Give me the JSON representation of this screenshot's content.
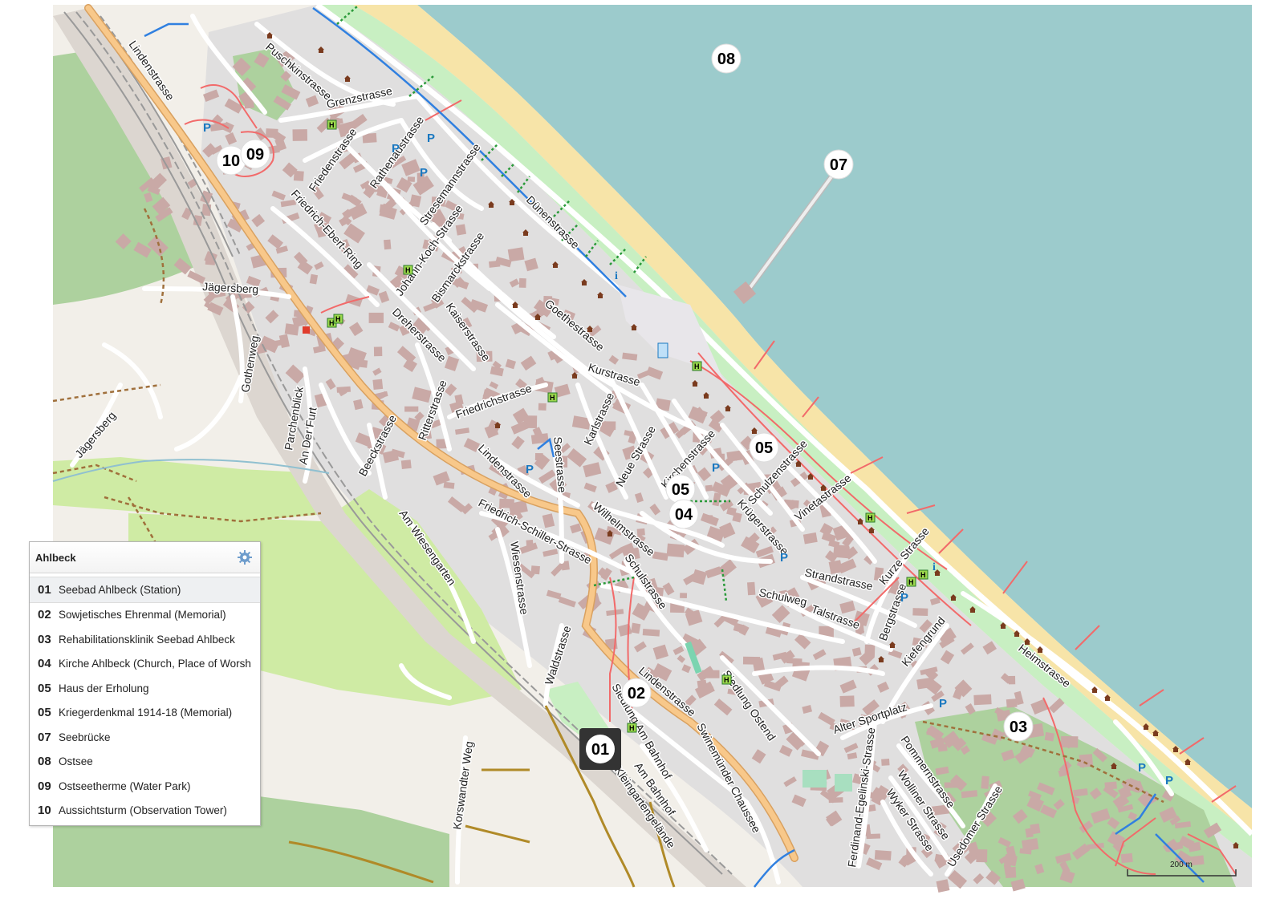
{
  "legend": {
    "title": "Ahlbeck",
    "settings_icon": "gear-icon",
    "items": [
      {
        "num": "01",
        "label": "Seebad Ahlbeck (Station)"
      },
      {
        "num": "02",
        "label": "Sowjetisches Ehrenmal (Memorial)"
      },
      {
        "num": "03",
        "label": "Rehabilitationsklinik Seebad Ahlbeck"
      },
      {
        "num": "04",
        "label": "Kirche Ahlbeck (Church, Place of Worsh"
      },
      {
        "num": "05",
        "label": "Haus der Erholung"
      },
      {
        "num": "05",
        "label": "Kriegerdenkmal 1914-18 (Memorial)"
      },
      {
        "num": "07",
        "label": "Seebrücke"
      },
      {
        "num": "08",
        "label": "Ostsee"
      },
      {
        "num": "09",
        "label": "Ostseetherme (Water Park)"
      },
      {
        "num": "10",
        "label": "Aussichtsturm (Observation Tower)"
      }
    ]
  },
  "markers": {
    "m01": "01",
    "m02": "02",
    "m03": "03",
    "m04": "04",
    "m05a": "05",
    "m05b": "05",
    "m07": "07",
    "m08": "08",
    "m09": "09",
    "m10": "10"
  },
  "streets": {
    "lindenstrasse_nw": "Lindenstrasse",
    "puschkinstrasse": "Puschkinstrasse",
    "grenzstrasse": "Grenzstrasse",
    "friedenstrasse": "Friedenstrasse",
    "rathenaustrasse": "Rathenaustrasse",
    "stresemannstrasse": "Stresemannstrasse",
    "friedrich_ebert_ring": "Friedrich-Ebert-Ring",
    "johann_koch_strasse": "Johann-Koch-Strasse",
    "bismarckstrasse": "Bismarckstrasse",
    "dunenstrasse": "Dünenstrasse",
    "jagersberg": "Jägersberg",
    "jagersberg_sw": "Jägersberg",
    "gothenweg": "Gothenweg",
    "parchenblick": "Parchenblick",
    "an_der_furt": "An Der Furt",
    "dreherstrasse": "Dreherstrasse",
    "kaiserstrasse": "Kaiserstrasse",
    "goethestrasse": "Goethestrasse",
    "kurstrasse": "Kurstrasse",
    "friedrichstrasse": "Friedrichstrasse",
    "ritterstrasse": "Ritterstrasse",
    "beeckstrasse": "Beeckstrasse",
    "karlstrasse": "Karlstrasse",
    "seestrasse": "Seestrasse",
    "neue_strasse": "Neue Strasse",
    "kirchenstrasse": "Kirchenstrasse",
    "schulzenstrasse": "Schulzenstrasse",
    "lindenstrasse_mid": "Lindenstrasse",
    "wilhelmstrasse": "Wilhelmstrasse",
    "vinetastrasse": "Vinetastrasse",
    "krugerstrasse": "Krügerstrasse",
    "friedrich_schiller_strasse": "Friedrich-Schiller-Strasse",
    "am_wiesengarten": "Am Wiesengarten",
    "wiesenstrasse": "Wiesenstrasse",
    "schulstrasse": "Schulstrasse",
    "strandstrasse": "Strandstrasse",
    "kurze_strasse": "Kurze Strasse",
    "schulweg": "Schulweg",
    "talstrasse": "Talstrasse",
    "bergstrasse": "Bergstrasse",
    "kiefengrund": "Kiefengrund",
    "heimstrasse": "Heimstrasse",
    "waldstrasse": "Waldstrasse",
    "lindenstrasse_se": "Lindenstrasse",
    "swinemunder_chaussee": "Swinemünder Chaussee",
    "siedlung_ostend": "Siedlung Ostend",
    "siedlung_am_bahnhof": "Siedlung Am Bahnhof",
    "am_bahnhof": "Am Bahnhof",
    "kleingartengelande": "Kleingartengelände",
    "alter_sportplatz": "Alter Sportplatz",
    "ferdinand_egelinski_strasse": "Ferdinand-Egelinski-Strasse",
    "pommernstrasse": "Pommernstrasse",
    "wolliner_strasse": "Wolliner Strasse",
    "wyker_strasse": "Wyker Strasse",
    "usedomer_strasse": "Usedomer Strasse",
    "korswandter_weg": "Korswandter Weg"
  },
  "scale_label": "200 m",
  "parking_label": "P",
  "bus_label": "H",
  "info_label": "i",
  "colors": {
    "sea": "#9ccbcc",
    "beach": "#f7e4a8",
    "land": "#f2efe9",
    "residential": "#e0dfdf",
    "building": "#c9a9a6",
    "park": "#c8efc2",
    "forest": "#add19e",
    "main_road": "#f8c88a",
    "path_red": "#f26a6a",
    "cycle_blue": "#3080e0",
    "track_brown": "#a0703c",
    "marker_bg": "#ffffff",
    "marker_dark": "#333333"
  }
}
